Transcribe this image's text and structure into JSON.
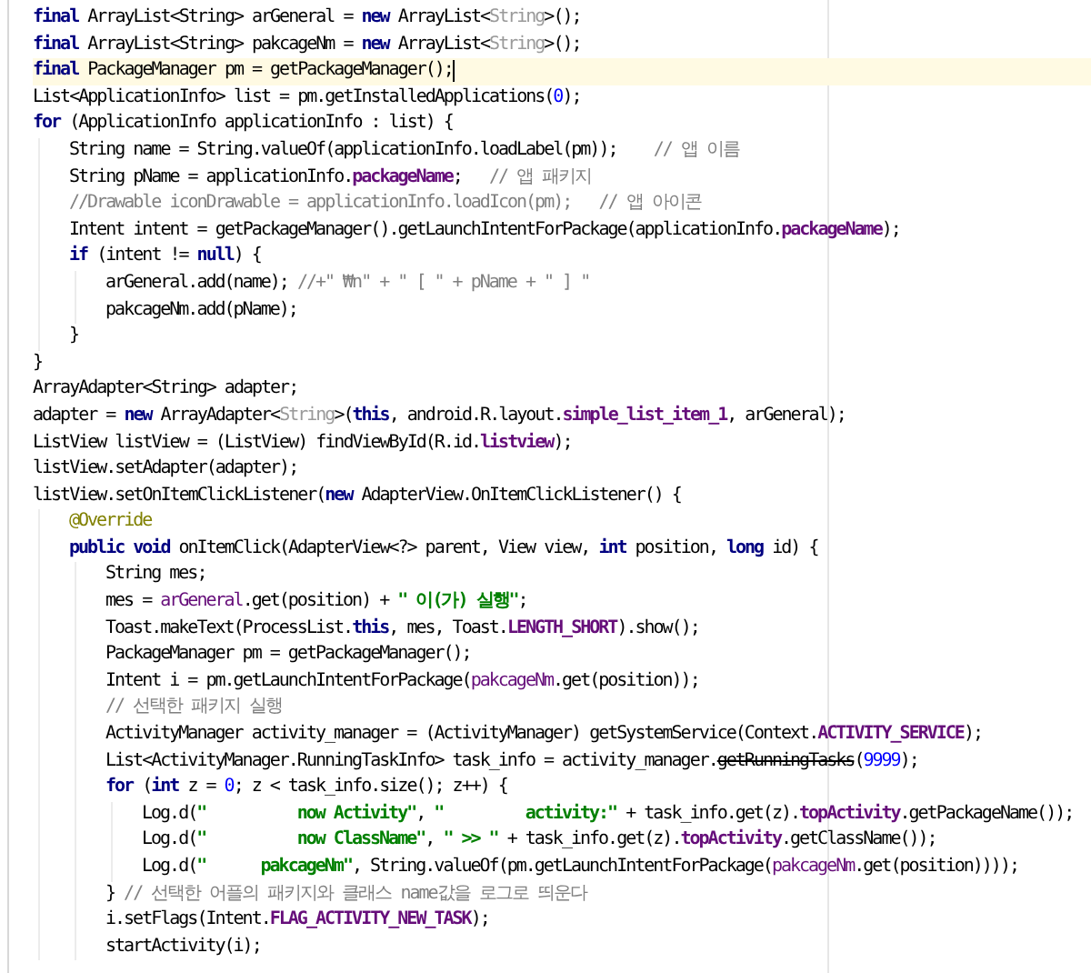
{
  "editor": {
    "lines": [
      {
        "current": false,
        "tokens": [
          {
            "kind": "keyword",
            "text": "final"
          },
          {
            "kind": "plain",
            "text": " ArrayList<String> arGeneral = "
          },
          {
            "kind": "keyword",
            "text": "new"
          },
          {
            "kind": "plain",
            "text": " ArrayList<"
          },
          {
            "kind": "inferred",
            "text": "String"
          },
          {
            "kind": "plain",
            "text": ">();"
          }
        ]
      },
      {
        "current": false,
        "tokens": [
          {
            "kind": "keyword",
            "text": "final"
          },
          {
            "kind": "plain",
            "text": " ArrayList<String> pakcageNm = "
          },
          {
            "kind": "keyword",
            "text": "new"
          },
          {
            "kind": "plain",
            "text": " ArrayList<"
          },
          {
            "kind": "inferred",
            "text": "String"
          },
          {
            "kind": "plain",
            "text": ">();"
          }
        ]
      },
      {
        "current": true,
        "tokens": [
          {
            "kind": "keyword",
            "text": "final"
          },
          {
            "kind": "plain",
            "text": " PackageManager pm = getPackageManager();"
          }
        ]
      },
      {
        "current": false,
        "tokens": [
          {
            "kind": "plain",
            "text": "List<ApplicationInfo> list = pm.getInstalledApplications("
          },
          {
            "kind": "number",
            "text": "0"
          },
          {
            "kind": "plain",
            "text": ");"
          }
        ]
      },
      {
        "current": false,
        "tokens": [
          {
            "kind": "keyword",
            "text": "for"
          },
          {
            "kind": "plain",
            "text": " (ApplicationInfo applicationInfo : list) {"
          }
        ],
        "children": [
          {
            "current": false,
            "tokens": [
              {
                "kind": "plain",
                "text": "String name = String.valueOf(applicationInfo.loadLabel(pm));    "
              },
              {
                "kind": "comment",
                "text": "// 앱 이름"
              }
            ]
          },
          {
            "current": false,
            "tokens": [
              {
                "kind": "plain",
                "text": "String pName = applicationInfo."
              },
              {
                "kind": "field",
                "text": "packageName"
              },
              {
                "kind": "plain",
                "text": ";   "
              },
              {
                "kind": "comment",
                "text": "// 앱 패키지"
              }
            ]
          },
          {
            "current": false,
            "tokens": [
              {
                "kind": "comment",
                "text": "//Drawable iconDrawable = applicationInfo.loadIcon(pm);   // 앱 아이콘"
              }
            ]
          },
          {
            "current": false,
            "tokens": [
              {
                "kind": "plain",
                "text": "Intent intent = getPackageManager().getLaunchIntentForPackage(applicationInfo."
              },
              {
                "kind": "field",
                "text": "packageName"
              },
              {
                "kind": "plain",
                "text": ");"
              }
            ]
          },
          {
            "current": false,
            "tokens": [
              {
                "kind": "keyword",
                "text": "if"
              },
              {
                "kind": "plain",
                "text": " (intent != "
              },
              {
                "kind": "keyword",
                "text": "null"
              },
              {
                "kind": "plain",
                "text": ") {"
              }
            ],
            "children": [
              {
                "current": false,
                "tokens": [
                  {
                    "kind": "plain",
                    "text": "arGeneral.add(name); "
                  },
                  {
                    "kind": "comment",
                    "text": "//+\" ₩n\" + \" [ \" + pName + \" ] \""
                  }
                ]
              },
              {
                "current": false,
                "tokens": [
                  {
                    "kind": "plain",
                    "text": "pakcageNm.add(pName);"
                  }
                ]
              }
            ]
          },
          {
            "current": false,
            "tokens": [
              {
                "kind": "plain",
                "text": "}"
              }
            ]
          }
        ]
      },
      {
        "current": false,
        "tokens": [
          {
            "kind": "plain",
            "text": "}"
          }
        ]
      },
      {
        "current": false,
        "tokens": [
          {
            "kind": "plain",
            "text": "ArrayAdapter<String> adapter;"
          }
        ]
      },
      {
        "current": false,
        "tokens": [
          {
            "kind": "plain",
            "text": "adapter = "
          },
          {
            "kind": "keyword",
            "text": "new"
          },
          {
            "kind": "plain",
            "text": " ArrayAdapter<"
          },
          {
            "kind": "inferred",
            "text": "String"
          },
          {
            "kind": "plain",
            "text": ">("
          },
          {
            "kind": "keyword",
            "text": "this"
          },
          {
            "kind": "plain",
            "text": ", android.R.layout."
          },
          {
            "kind": "field",
            "text": "simple_list_item_1"
          },
          {
            "kind": "plain",
            "text": ", arGeneral);"
          }
        ]
      },
      {
        "current": false,
        "tokens": [
          {
            "kind": "plain",
            "text": "ListView listView = (ListView) findViewById(R.id."
          },
          {
            "kind": "field",
            "text": "listview"
          },
          {
            "kind": "plain",
            "text": ");"
          }
        ]
      },
      {
        "current": false,
        "tokens": [
          {
            "kind": "plain",
            "text": "listView.setAdapter(adapter);"
          }
        ]
      },
      {
        "current": false,
        "tokens": [
          {
            "kind": "plain",
            "text": "listView.setOnItemClickListener("
          },
          {
            "kind": "keyword",
            "text": "new"
          },
          {
            "kind": "plain",
            "text": " AdapterView.OnItemClickListener() {"
          }
        ],
        "children": [
          {
            "current": false,
            "tokens": [
              {
                "kind": "annotation",
                "text": "@Override"
              }
            ]
          },
          {
            "current": false,
            "tokens": [
              {
                "kind": "keyword",
                "text": "public void"
              },
              {
                "kind": "plain",
                "text": " onItemClick(AdapterView<?> parent, View view, "
              },
              {
                "kind": "keyword",
                "text": "int"
              },
              {
                "kind": "plain",
                "text": " position, "
              },
              {
                "kind": "keyword",
                "text": "long"
              },
              {
                "kind": "plain",
                "text": " id) {"
              }
            ],
            "children": [
              {
                "current": false,
                "tokens": [
                  {
                    "kind": "plain",
                    "text": "String mes;"
                  }
                ]
              },
              {
                "current": false,
                "tokens": [
                  {
                    "kind": "plain",
                    "text": "mes = "
                  },
                  {
                    "kind": "captured",
                    "text": "arGeneral"
                  },
                  {
                    "kind": "plain",
                    "text": ".get(position) + "
                  },
                  {
                    "kind": "string",
                    "text": "\" 이(가) 실행\""
                  },
                  {
                    "kind": "plain",
                    "text": ";"
                  }
                ]
              },
              {
                "current": false,
                "tokens": [
                  {
                    "kind": "plain",
                    "text": "Toast.makeText(ProcessList."
                  },
                  {
                    "kind": "keyword",
                    "text": "this"
                  },
                  {
                    "kind": "plain",
                    "text": ", mes, Toast."
                  },
                  {
                    "kind": "constant",
                    "text": "LENGTH_SHORT"
                  },
                  {
                    "kind": "plain",
                    "text": ").show();"
                  }
                ]
              },
              {
                "current": false,
                "tokens": [
                  {
                    "kind": "plain",
                    "text": "PackageManager pm = getPackageManager();"
                  }
                ]
              },
              {
                "current": false,
                "tokens": [
                  {
                    "kind": "plain",
                    "text": "Intent i = pm.getLaunchIntentForPackage("
                  },
                  {
                    "kind": "captured",
                    "text": "pakcageNm"
                  },
                  {
                    "kind": "plain",
                    "text": ".get(position));"
                  }
                ]
              },
              {
                "current": false,
                "tokens": [
                  {
                    "kind": "comment",
                    "text": "// 선택한 패키지 실행"
                  }
                ]
              },
              {
                "current": false,
                "tokens": [
                  {
                    "kind": "plain",
                    "text": "ActivityManager activity_manager = (ActivityManager) getSystemService(Context."
                  },
                  {
                    "kind": "constant",
                    "text": "ACTIVITY_SERVICE"
                  },
                  {
                    "kind": "plain",
                    "text": ");"
                  }
                ]
              },
              {
                "current": false,
                "tokens": [
                  {
                    "kind": "plain",
                    "text": "List<ActivityManager.RunningTaskInfo> task_info = activity_manager."
                  },
                  {
                    "kind": "deprecated",
                    "text": "getRunningTasks"
                  },
                  {
                    "kind": "plain",
                    "text": "("
                  },
                  {
                    "kind": "number",
                    "text": "9999"
                  },
                  {
                    "kind": "plain",
                    "text": ");"
                  }
                ]
              },
              {
                "current": false,
                "tokens": [
                  {
                    "kind": "keyword",
                    "text": "for"
                  },
                  {
                    "kind": "plain",
                    "text": " ("
                  },
                  {
                    "kind": "keyword",
                    "text": "int"
                  },
                  {
                    "kind": "plain",
                    "text": " z = "
                  },
                  {
                    "kind": "number",
                    "text": "0"
                  },
                  {
                    "kind": "plain",
                    "text": "; z < task_info.size(); z++) {"
                  }
                ],
                "children": [
                  {
                    "current": false,
                    "tokens": [
                      {
                        "kind": "plain",
                        "text": "Log.d("
                      },
                      {
                        "kind": "string",
                        "text": "\"          now Activity\""
                      },
                      {
                        "kind": "plain",
                        "text": ", "
                      },
                      {
                        "kind": "string",
                        "text": "\"         activity:\""
                      },
                      {
                        "kind": "plain",
                        "text": " + task_info.get(z)."
                      },
                      {
                        "kind": "field",
                        "text": "topActivity"
                      },
                      {
                        "kind": "plain",
                        "text": ".getPackageName());"
                      }
                    ]
                  },
                  {
                    "current": false,
                    "tokens": [
                      {
                        "kind": "plain",
                        "text": "Log.d("
                      },
                      {
                        "kind": "string",
                        "text": "\"          now ClassName\""
                      },
                      {
                        "kind": "plain",
                        "text": ", "
                      },
                      {
                        "kind": "string",
                        "text": "\" >> \""
                      },
                      {
                        "kind": "plain",
                        "text": " + task_info.get(z)."
                      },
                      {
                        "kind": "field",
                        "text": "topActivity"
                      },
                      {
                        "kind": "plain",
                        "text": ".getClassName());"
                      }
                    ]
                  },
                  {
                    "current": false,
                    "tokens": [
                      {
                        "kind": "plain",
                        "text": "Log.d("
                      },
                      {
                        "kind": "string",
                        "text": "\"      pakcageNm\""
                      },
                      {
                        "kind": "plain",
                        "text": ", String.valueOf(pm.getLaunchIntentForPackage("
                      },
                      {
                        "kind": "captured",
                        "text": "pakcageNm"
                      },
                      {
                        "kind": "plain",
                        "text": ".get(position))));"
                      }
                    ]
                  }
                ]
              },
              {
                "current": false,
                "tokens": [
                  {
                    "kind": "plain",
                    "text": "} "
                  },
                  {
                    "kind": "comment",
                    "text": "// 선택한 어플의 패키지와 클래스 name값을 로그로 띄운다"
                  }
                ]
              },
              {
                "current": false,
                "tokens": [
                  {
                    "kind": "plain",
                    "text": "i.setFlags(Intent."
                  },
                  {
                    "kind": "constant",
                    "text": "FLAG_ACTIVITY_NEW_TASK"
                  },
                  {
                    "kind": "plain",
                    "text": ");"
                  }
                ]
              },
              {
                "current": false,
                "tokens": [
                  {
                    "kind": "plain",
                    "text": "startActivity(i);"
                  }
                ]
              }
            ]
          }
        ]
      }
    ]
  }
}
